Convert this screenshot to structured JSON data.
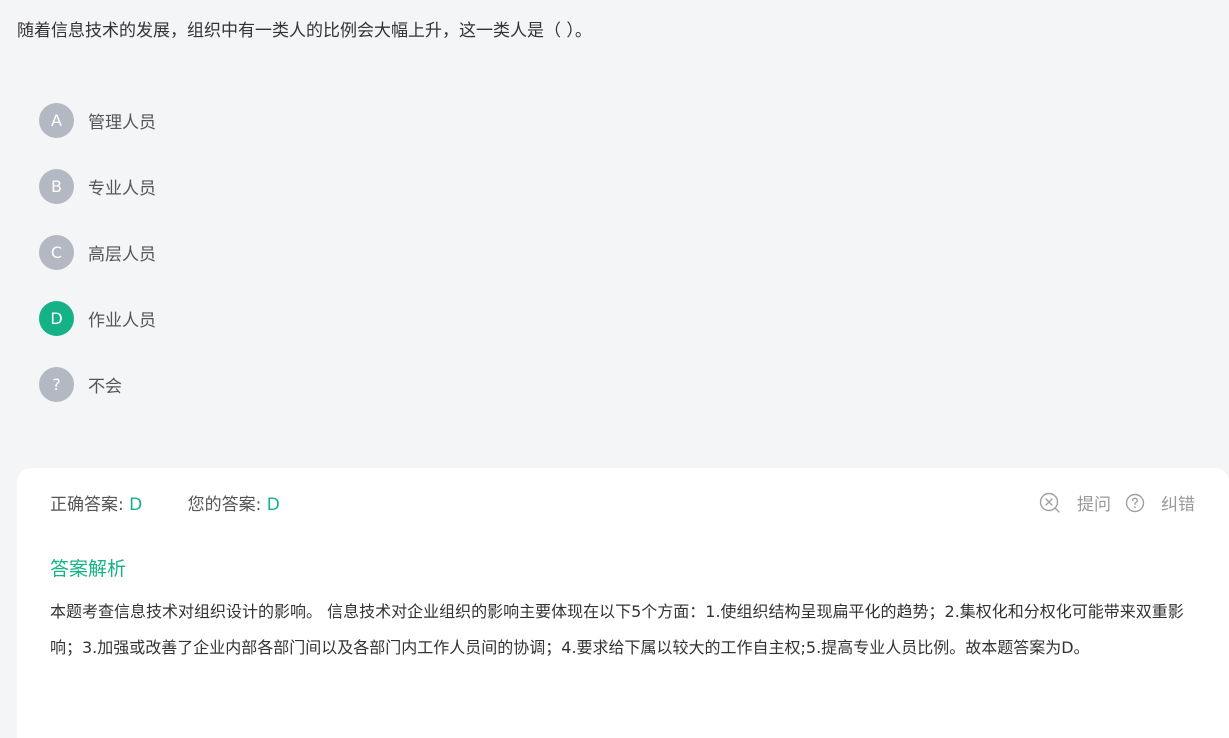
{
  "question": {
    "text": "随着信息技术的发展，组织中有一类人的比例会大幅上升，这一类人是（ ）。"
  },
  "options": [
    {
      "letter": "A",
      "text": "管理人员"
    },
    {
      "letter": "B",
      "text": "专业人员"
    },
    {
      "letter": "C",
      "text": "高层人员"
    },
    {
      "letter": "D",
      "text": "作业人员"
    },
    {
      "letter": "?",
      "text": "不会"
    }
  ],
  "selected_option": "D",
  "result": {
    "correct_label": "正确答案:",
    "correct_value": "D",
    "yours_label": "您的答案:",
    "yours_value": "D"
  },
  "actions": {
    "ask_label": "提问",
    "ask_icon": "close-circle-icon",
    "report_label": "纠错",
    "report_icon": "question-circle-icon"
  },
  "analysis": {
    "title": "答案解析",
    "body": "本题考查信息技术对组织设计的影响。 信息技术对企业组织的影响主要体现在以下5个方面：1.使组织结构呈现扁平化的趋势；2.集权化和分权化可能带来双重影响；3.加强或改善了企业内部各部门间以及各部门内工作人员间的协调；4.要求给下属以较大的工作自主权;5.提高专业人员比例。故本题答案为D。"
  },
  "colors": {
    "accent": "#16b287",
    "badge_default": "#b4b8c3",
    "page_bg": "#f4f5f7"
  }
}
